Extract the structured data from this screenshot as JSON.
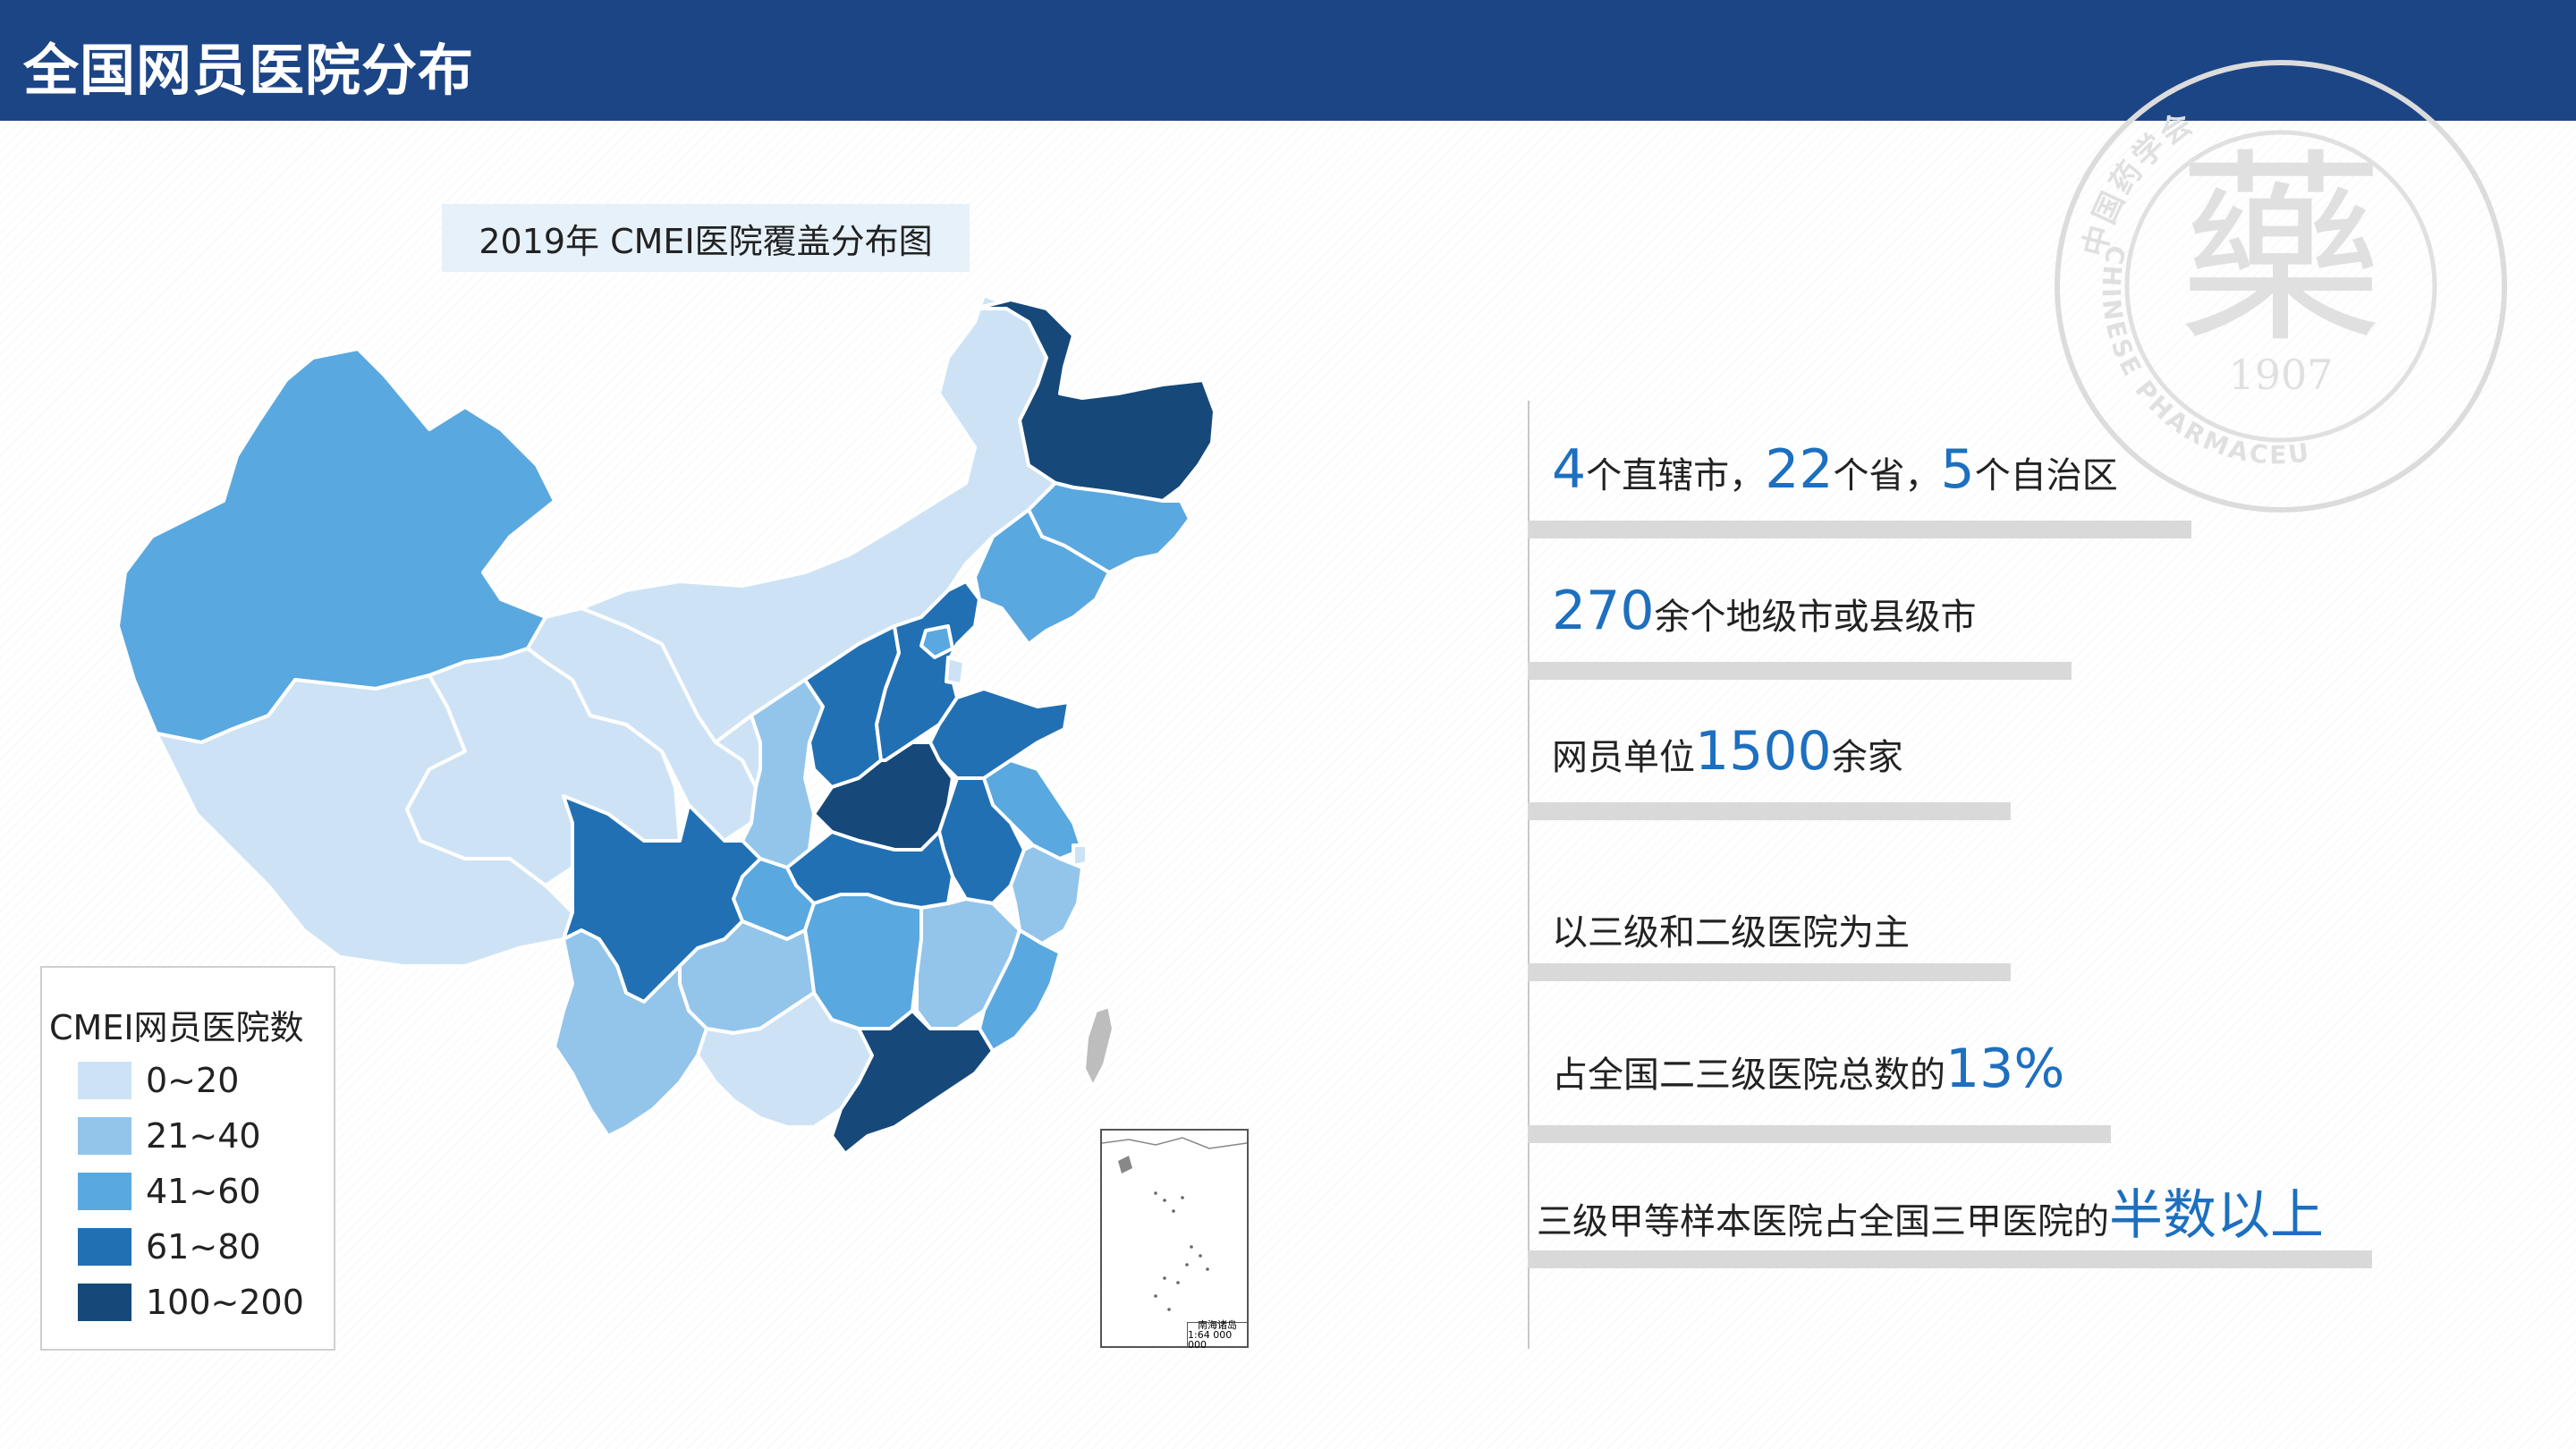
{
  "header": {
    "title": "全国网员医院分布"
  },
  "map": {
    "title": "2019年 CMEI医院覆盖分布图",
    "legend": {
      "title": "CMEI网员医院数",
      "items": [
        {
          "label": "0~20",
          "color": "#cde3f5"
        },
        {
          "label": "21~40",
          "color": "#93c5eb"
        },
        {
          "label": "41~60",
          "color": "#5aa8e0"
        },
        {
          "label": "61~80",
          "color": "#2270b4"
        },
        {
          "label": "100~200",
          "color": "#16497a"
        }
      ]
    },
    "inset_label": "南海诸岛",
    "inset_scale": "1:64 000 000"
  },
  "stats": [
    {
      "parts": [
        {
          "t": "4",
          "big": true
        },
        {
          "t": "个直辖市，",
          "big": false
        },
        {
          "t": "22",
          "big": true
        },
        {
          "t": "个省，",
          "big": false
        },
        {
          "t": "5",
          "big": true
        },
        {
          "t": "个自治区",
          "big": false
        }
      ]
    },
    {
      "parts": [
        {
          "t": "270",
          "big": true
        },
        {
          "t": "余个地级市或县级市",
          "big": false
        }
      ]
    },
    {
      "parts": [
        {
          "t": "网员单位",
          "big": false
        },
        {
          "t": "1500",
          "big": true
        },
        {
          "t": "余家",
          "big": false
        }
      ]
    },
    {
      "parts": [
        {
          "t": "以三级和二级医院为主",
          "big": false
        }
      ]
    },
    {
      "parts": [
        {
          "t": "占全国二三级医院总数的",
          "big": false
        },
        {
          "t": "13%",
          "big": true
        }
      ]
    },
    {
      "parts": [
        {
          "t": "三级甲等样本医院占全国三甲医院的",
          "big": false
        },
        {
          "t": "半数以上",
          "big": true
        }
      ]
    }
  ],
  "seal": {
    "char": "藥",
    "year": "1907",
    "ring_text": "CHINESE PHARMACEUTICAL ASSOCIATION",
    "top_text": "中国药学会"
  }
}
